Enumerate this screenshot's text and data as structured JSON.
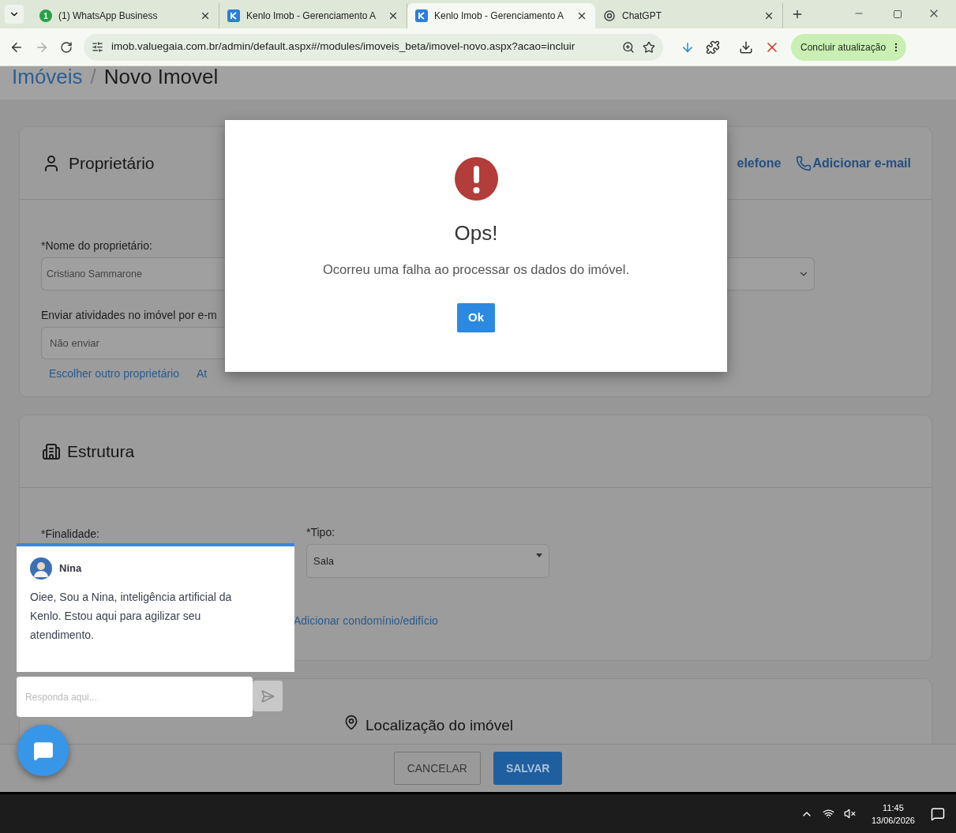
{
  "browser": {
    "tabs": [
      {
        "kind": "badge",
        "badge": "1",
        "title": "(1) WhatsApp Business",
        "selected": false
      },
      {
        "kind": "k",
        "title": "Kenlo Imob - Gerenciamento A",
        "selected": false
      },
      {
        "kind": "k",
        "title": "Kenlo Imob - Gerenciamento A",
        "selected": true
      },
      {
        "kind": "gpt",
        "title": "ChatGPT",
        "selected": false
      }
    ],
    "url": "imob.valuegaia.com.br/admin/default.aspx#/modules/imoveis_beta/imovel-novo.aspx?acao=incluir",
    "update_button": "Concluir atualização"
  },
  "breadcrumb": {
    "parent": "Imóveis",
    "separator": "/",
    "current": "Novo Imovel"
  },
  "owner_section": {
    "title": "Proprietário",
    "actions": [
      "elefone",
      "Adicionar e-mail"
    ],
    "name_label": "*Nome do proprietário:",
    "name_value": "Cristiano Sammarone",
    "email_label": "Enviar atividades no imóvel por e-m",
    "email_value": "Não enviar",
    "links": [
      "Escolher outro proprietário",
      "At"
    ]
  },
  "structure_section": {
    "title": "Estrutura",
    "purpose_label": "*Finalidade:",
    "type_label": "*Tipo:",
    "type_value": "Sala",
    "link": "Adicionar condomínio/edifício"
  },
  "location_section": {
    "title": "Localização do imóvel"
  },
  "modal": {
    "title": "Ops!",
    "message": "Ocorreu uma falha ao processar os dados do imóvel.",
    "button": "Ok"
  },
  "chat": {
    "agent": "Nina",
    "message": "Oiee, Sou a Nina, inteligência artificial da Kenlo. Estou aqui para agilizar seu atendimento.",
    "placeholder": "Responda aqui..."
  },
  "footer": {
    "cancel": "CANCELAR",
    "save": "SALVAR"
  },
  "taskbar": {
    "time": "11:45",
    "date": "13/06/2026"
  }
}
